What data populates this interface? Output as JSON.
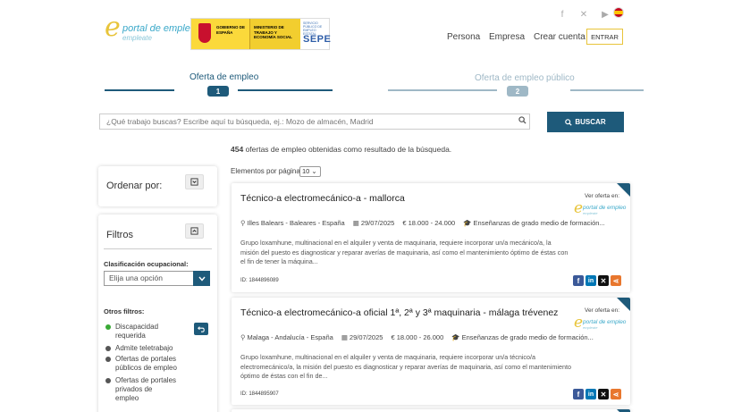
{
  "header": {
    "logo_line1": "portal de empleo",
    "logo_line2": "empleate",
    "gov_text": "GOBIERNO DE ESPAÑA",
    "ministry_text": "MINISTERIO DE TRABAJO Y ECONOMÍA SOCIAL",
    "sepe_small": "SERVICIO PÚBLICO DE EMPLEO ESTATAL",
    "sepe_big": "SEPE",
    "nav": [
      "Persona",
      "Empresa",
      "Crear cuenta"
    ],
    "login_label": "ENTRAR"
  },
  "steps": [
    {
      "label": "Oferta de empleo",
      "number": "1",
      "color": "#1e5a7a"
    },
    {
      "label": "Oferta de empleo público",
      "number": "2",
      "color": "#9fb8c6"
    }
  ],
  "search": {
    "placeholder": "¿Qué trabajo buscas? Escribe aquí tu búsqueda, ej.: Mozo de almacén, Madrid",
    "button_label": "BUSCAR"
  },
  "results": {
    "count": "454",
    "text": "ofertas de empleo obtenidas como resultado de la búsqueda."
  },
  "sidebar": {
    "sort_label": "Ordenar por:",
    "filters_label": "Filtros",
    "classification_label": "Clasificación ocupacional:",
    "classification_value": "Elija una opción",
    "other_filters_label": "Otros filtros:",
    "filters": [
      {
        "label": "Discapacidad requerida",
        "color": "#39a935"
      },
      {
        "label": "Admite teletrabajo",
        "color": "#555555"
      },
      {
        "label": "Ofertas de portales públicos de empleo",
        "color": "#555555"
      },
      {
        "label": "Ofertas de portales privados de empleo",
        "color": "#555555"
      }
    ]
  },
  "pagination": {
    "items_label": "Elementos por página",
    "items_value": "10"
  },
  "jobs": [
    {
      "title": "Técnico-a electromecánico-a - mallorca",
      "ver_oferta": "Ver oferta en:",
      "location": "Illes Balears - Baleares - España",
      "date": "29/07/2025",
      "salary": "€ 18.000 - 24.000",
      "education": "Enseñanzas de grado medio de formación...",
      "description": "Grupo loxamhune, multinacional en el alquiler y venta de maquinaria, requiere incorporar un/a mecánico/a, la misión del puesto es diagnosticar y reparar averías de maquinaria, así como el mantenimiento óptimo de éstas con el fin de tener la máquina...",
      "id": "ID: 1844896089"
    },
    {
      "title": "Técnico-a electromecánico-a oficial 1ª, 2ª y 3ª maquinaria - málaga trévenez",
      "ver_oferta": "Ver oferta en:",
      "location": "Malaga - Andalucía - España",
      "date": "29/07/2025",
      "salary": "€ 18.000 - 26.000",
      "education": "Enseñanzas de grado medio de formación...",
      "description": "Grupo loxamhune, multinacional en el alquiler y venta de maquinaria, requiere incorporar un/a técnico/a electromecánico/a, la misión del puesto es diagnosticar y reparar averías de maquinaria, así como el mantenimiento óptimo de éstas con el fin de...",
      "id": "ID: 1844895907"
    }
  ],
  "share_colors": {
    "facebook": "#3b5998",
    "linkedin": "#0077b5",
    "x": "#111111",
    "share": "#e8772e"
  }
}
